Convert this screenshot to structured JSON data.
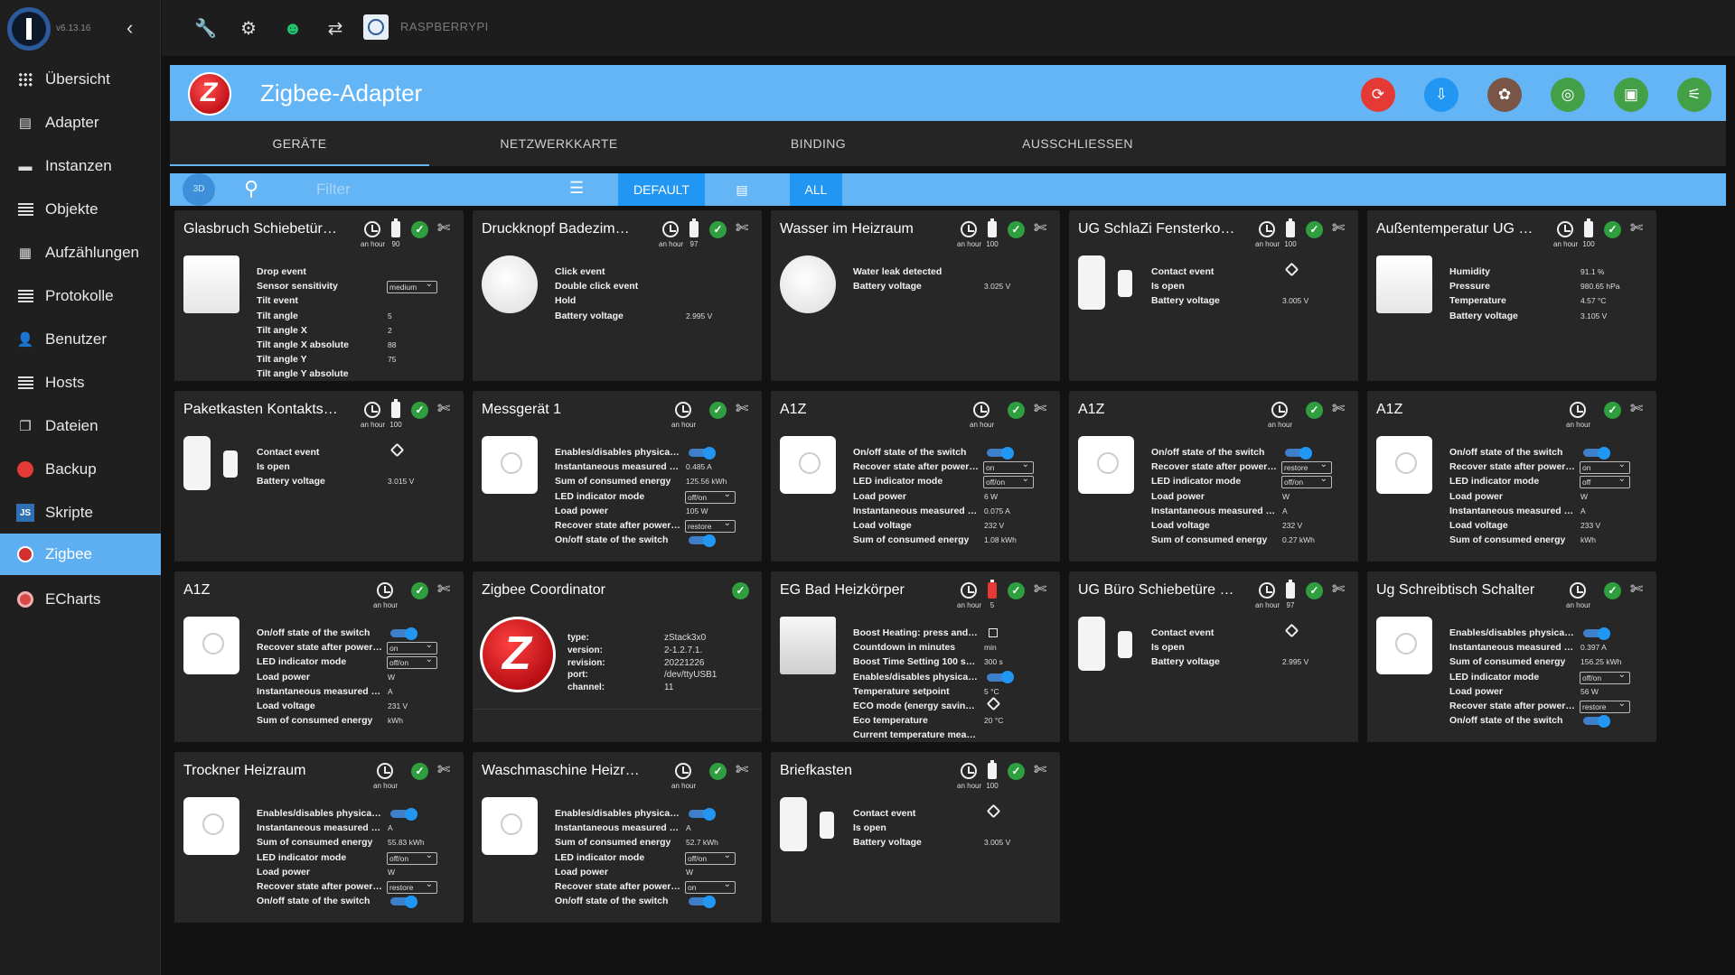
{
  "app": {
    "version": "v6.13.16",
    "host": "RASPBERRYPI"
  },
  "sidebar": {
    "items": [
      {
        "label": "Übersicht"
      },
      {
        "label": "Adapter"
      },
      {
        "label": "Instanzen"
      },
      {
        "label": "Objekte"
      },
      {
        "label": "Aufzählungen"
      },
      {
        "label": "Protokolle"
      },
      {
        "label": "Benutzer"
      },
      {
        "label": "Hosts"
      },
      {
        "label": "Dateien"
      },
      {
        "label": "Backup"
      },
      {
        "label": "Skripte"
      },
      {
        "label": "Zigbee"
      },
      {
        "label": "ECharts"
      }
    ]
  },
  "header": {
    "title": "Zigbee-Adapter"
  },
  "tabs": [
    {
      "label": "GERÄTE"
    },
    {
      "label": "NETZWERKKARTE"
    },
    {
      "label": "BINDING"
    },
    {
      "label": "AUSSCHLIESSEN"
    }
  ],
  "toolbar": {
    "badge_3d": "3D",
    "filter_placeholder": "Filter",
    "default_label": "DEFAULT",
    "all_label": "ALL"
  },
  "colors": {
    "accent": "#64b5f6",
    "header_buttons": [
      "#e53935",
      "#2196f3",
      "#795548",
      "#43a047",
      "#43a047",
      "#43a047"
    ]
  },
  "cards": [
    {
      "title": "Glasbruch Schiebetür…",
      "time": "an hour",
      "battery": "90",
      "states": [
        {
          "l": "Drop event",
          "v": ""
        },
        {
          "l": "Sensor sensitivity",
          "v": "medium"
        },
        {
          "l": "Tilt event",
          "v": ""
        },
        {
          "l": "Tilt angle",
          "v": "5"
        },
        {
          "l": "Tilt angle X",
          "v": "2"
        },
        {
          "l": "Tilt angle X absolute",
          "v": "88"
        },
        {
          "l": "Tilt angle Y",
          "v": "75"
        },
        {
          "l": "Tilt angle Y absolute",
          "v": ""
        }
      ]
    },
    {
      "title": "Druckknopf Badezim…",
      "time": "an hour",
      "battery": "97",
      "states": [
        {
          "l": "Click event",
          "v": ""
        },
        {
          "l": "Double click event",
          "v": ""
        },
        {
          "l": "Hold",
          "v": ""
        },
        {
          "l": "Battery voltage",
          "v": "2.995 V"
        }
      ]
    },
    {
      "title": "Wasser im Heizraum",
      "time": "an hour",
      "battery": "100",
      "states": [
        {
          "l": "Water leak detected",
          "v": ""
        },
        {
          "l": "Battery voltage",
          "v": "3.025 V"
        }
      ]
    },
    {
      "title": "UG SchlaZi Fensterko…",
      "time": "an hour",
      "battery": "100",
      "states": [
        {
          "l": "Contact event",
          "v": ""
        },
        {
          "l": "Is open",
          "v": ""
        },
        {
          "l": "Battery voltage",
          "v": "3.005 V"
        }
      ]
    },
    {
      "title": "Außentemperatur UG …",
      "time": "an hour",
      "battery": "100",
      "states": [
        {
          "l": "Humidity",
          "v": "91.1 %"
        },
        {
          "l": "Pressure",
          "v": "980.65 hPa"
        },
        {
          "l": "Temperature",
          "v": "4.57 °C"
        },
        {
          "l": "Battery voltage",
          "v": "3.105 V"
        }
      ]
    },
    {
      "title": "Paketkasten Kontakts…",
      "time": "an hour",
      "battery": "100",
      "states": [
        {
          "l": "Contact event",
          "v": ""
        },
        {
          "l": "Is open",
          "v": ""
        },
        {
          "l": "Battery voltage",
          "v": "3.015 V"
        }
      ]
    },
    {
      "title": "Messgerät 1",
      "time": "an hour",
      "battery": "",
      "states": [
        {
          "l": "Enables/disables physical …",
          "v": ""
        },
        {
          "l": "Instantaneous measured el…",
          "v": "0.485 A"
        },
        {
          "l": "Sum of consumed energy",
          "v": "125.56 kWh"
        },
        {
          "l": "LED indicator mode",
          "v": "off/on"
        },
        {
          "l": "Load power",
          "v": "105 W"
        },
        {
          "l": "Recover state after power …",
          "v": "restore"
        },
        {
          "l": "On/off state of the switch",
          "v": ""
        }
      ]
    },
    {
      "title": "A1Z",
      "time": "an hour",
      "battery": "",
      "states": [
        {
          "l": "On/off state of the switch",
          "v": ""
        },
        {
          "l": "Recover state after power …",
          "v": "on"
        },
        {
          "l": "LED indicator mode",
          "v": "off/on"
        },
        {
          "l": "Load power",
          "v": "6 W"
        },
        {
          "l": "Instantaneous measured el…",
          "v": "0.075 A"
        },
        {
          "l": "Load voltage",
          "v": "232 V"
        },
        {
          "l": "Sum of consumed energy",
          "v": "1.08 kWh"
        }
      ]
    },
    {
      "title": "A1Z",
      "time": "an hour",
      "battery": "",
      "states": [
        {
          "l": "On/off state of the switch",
          "v": ""
        },
        {
          "l": "Recover state after power …",
          "v": "restore"
        },
        {
          "l": "LED indicator mode",
          "v": "off/on"
        },
        {
          "l": "Load power",
          "v": "W"
        },
        {
          "l": "Instantaneous measured el…",
          "v": "A"
        },
        {
          "l": "Load voltage",
          "v": "232 V"
        },
        {
          "l": "Sum of consumed energy",
          "v": "0.27 kWh"
        }
      ]
    },
    {
      "title": "A1Z",
      "time": "an hour",
      "battery": "",
      "states": [
        {
          "l": "On/off state of the switch",
          "v": ""
        },
        {
          "l": "Recover state after power …",
          "v": "on"
        },
        {
          "l": "LED indicator mode",
          "v": "off"
        },
        {
          "l": "Load power",
          "v": "W"
        },
        {
          "l": "Instantaneous measured el…",
          "v": "A"
        },
        {
          "l": "Load voltage",
          "v": "233 V"
        },
        {
          "l": "Sum of consumed energy",
          "v": "kWh"
        }
      ]
    },
    {
      "title": "A1Z",
      "time": "an hour",
      "battery": "",
      "states": [
        {
          "l": "On/off state of the switch",
          "v": ""
        },
        {
          "l": "Recover state after power …",
          "v": "on"
        },
        {
          "l": "LED indicator mode",
          "v": "off/on"
        },
        {
          "l": "Load power",
          "v": "W"
        },
        {
          "l": "Instantaneous measured el…",
          "v": "A"
        },
        {
          "l": "Load voltage",
          "v": "231 V"
        },
        {
          "l": "Sum of consumed energy",
          "v": "kWh"
        }
      ]
    },
    {
      "title": "Zigbee Coordinator",
      "time": "",
      "battery": "",
      "info": [
        {
          "k": "type:",
          "v": "zStack3x0"
        },
        {
          "k": "version:",
          "v": "2-1.2.7.1."
        },
        {
          "k": "revision:",
          "v": "20221226"
        },
        {
          "k": "port:",
          "v": "/dev/ttyUSB1"
        },
        {
          "k": "channel:",
          "v": "11"
        }
      ]
    },
    {
      "title": "EG Bad Heizkörper",
      "time": "an hour",
      "battery": "5",
      "states": [
        {
          "l": "Boost Heating: press and …",
          "v": ""
        },
        {
          "l": "Countdown in minutes",
          "v": "min"
        },
        {
          "l": "Boost Time Setting 100 se…",
          "v": "300 s"
        },
        {
          "l": "Enables/disables physical …",
          "v": ""
        },
        {
          "l": "Temperature setpoint",
          "v": "5 °C"
        },
        {
          "l": "ECO mode (energy saving …",
          "v": ""
        },
        {
          "l": "Eco temperature",
          "v": "20 °C"
        },
        {
          "l": "Current temperature meas…",
          "v": ""
        }
      ]
    },
    {
      "title": "UG Büro Schiebetüre …",
      "time": "an hour",
      "battery": "97",
      "states": [
        {
          "l": "Contact event",
          "v": ""
        },
        {
          "l": "Is open",
          "v": ""
        },
        {
          "l": "Battery voltage",
          "v": "2.995 V"
        }
      ]
    },
    {
      "title": "Ug Schreibtisch Schalter",
      "time": "an hour",
      "battery": "",
      "states": [
        {
          "l": "Enables/disables physical …",
          "v": ""
        },
        {
          "l": "Instantaneous measured el…",
          "v": "0.397 A"
        },
        {
          "l": "Sum of consumed energy",
          "v": "156.25 kWh"
        },
        {
          "l": "LED indicator mode",
          "v": "off/on"
        },
        {
          "l": "Load power",
          "v": "56 W"
        },
        {
          "l": "Recover state after power …",
          "v": "restore"
        },
        {
          "l": "On/off state of the switch",
          "v": ""
        }
      ]
    },
    {
      "title": "Trockner Heizraum",
      "time": "an hour",
      "battery": "",
      "states": [
        {
          "l": "Enables/disables physical …",
          "v": ""
        },
        {
          "l": "Instantaneous measured el…",
          "v": "A"
        },
        {
          "l": "Sum of consumed energy",
          "v": "55.83 kWh"
        },
        {
          "l": "LED indicator mode",
          "v": "off/on"
        },
        {
          "l": "Load power",
          "v": "W"
        },
        {
          "l": "Recover state after power …",
          "v": "restore"
        },
        {
          "l": "On/off state of the switch",
          "v": ""
        }
      ]
    },
    {
      "title": "Waschmaschine Heizraum",
      "time": "an hour",
      "battery": "",
      "states": [
        {
          "l": "Enables/disables physical …",
          "v": ""
        },
        {
          "l": "Instantaneous measured el…",
          "v": "A"
        },
        {
          "l": "Sum of consumed energy",
          "v": "52.7 kWh"
        },
        {
          "l": "LED indicator mode",
          "v": "off/on"
        },
        {
          "l": "Load power",
          "v": "W"
        },
        {
          "l": "Recover state after power …",
          "v": "on"
        },
        {
          "l": "On/off state of the switch",
          "v": ""
        }
      ]
    },
    {
      "title": "Briefkasten",
      "time": "an hour",
      "battery": "100",
      "states": [
        {
          "l": "Contact event",
          "v": ""
        },
        {
          "l": "Is open",
          "v": ""
        },
        {
          "l": "Battery voltage",
          "v": "3.005 V"
        }
      ]
    }
  ]
}
